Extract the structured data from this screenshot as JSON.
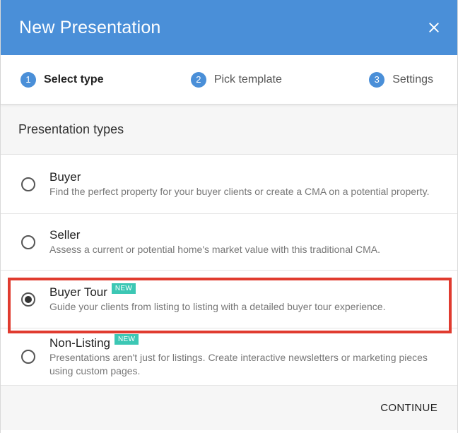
{
  "dialog": {
    "title": "New Presentation"
  },
  "steps": [
    {
      "number": "1",
      "label": "Select type"
    },
    {
      "number": "2",
      "label": "Pick template"
    },
    {
      "number": "3",
      "label": "Settings"
    }
  ],
  "section": {
    "heading": "Presentation types"
  },
  "options": [
    {
      "title": "Buyer",
      "description": "Find the perfect property for your buyer clients or create a CMA on a potential property.",
      "badge": "",
      "selected": false
    },
    {
      "title": "Seller",
      "description": "Assess a current or potential home's market value with this traditional CMA.",
      "badge": "",
      "selected": false
    },
    {
      "title": "Buyer Tour",
      "description": "Guide your clients from listing to listing with a detailed buyer tour experience.",
      "badge": "NEW",
      "selected": true
    },
    {
      "title": "Non-Listing",
      "description": "Presentations aren't just for listings. Create interactive newsletters or marketing pieces using custom pages.",
      "badge": "NEW",
      "selected": false
    }
  ],
  "footer": {
    "continue_label": "CONTINUE"
  },
  "colors": {
    "header": "#4a8fd8",
    "badge": "#3cc7b4",
    "highlight": "#e03b2f"
  }
}
